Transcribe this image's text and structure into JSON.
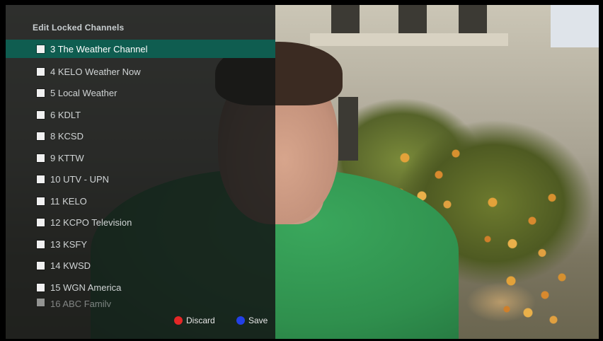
{
  "panel": {
    "title": "Edit Locked Channels"
  },
  "channels": [
    {
      "label": "3 The Weather Channel",
      "selected": true
    },
    {
      "label": "4 KELO Weather Now"
    },
    {
      "label": "5 Local Weather"
    },
    {
      "label": "6 KDLT"
    },
    {
      "label": "8 KCSD"
    },
    {
      "label": "9 KTTW"
    },
    {
      "label": "10 UTV - UPN"
    },
    {
      "label": "11 KELO"
    },
    {
      "label": "12 KCPO Television"
    },
    {
      "label": "13 KSFY"
    },
    {
      "label": "14 KWSD"
    },
    {
      "label": "15 WGN America"
    },
    {
      "label": "16 ABC Family"
    }
  ],
  "footer": {
    "discard_label": "Discard",
    "save_label": "Save"
  },
  "colors": {
    "selected_row": "#0f5d50",
    "discard_dot": "#e42727",
    "save_dot": "#2340e6"
  }
}
